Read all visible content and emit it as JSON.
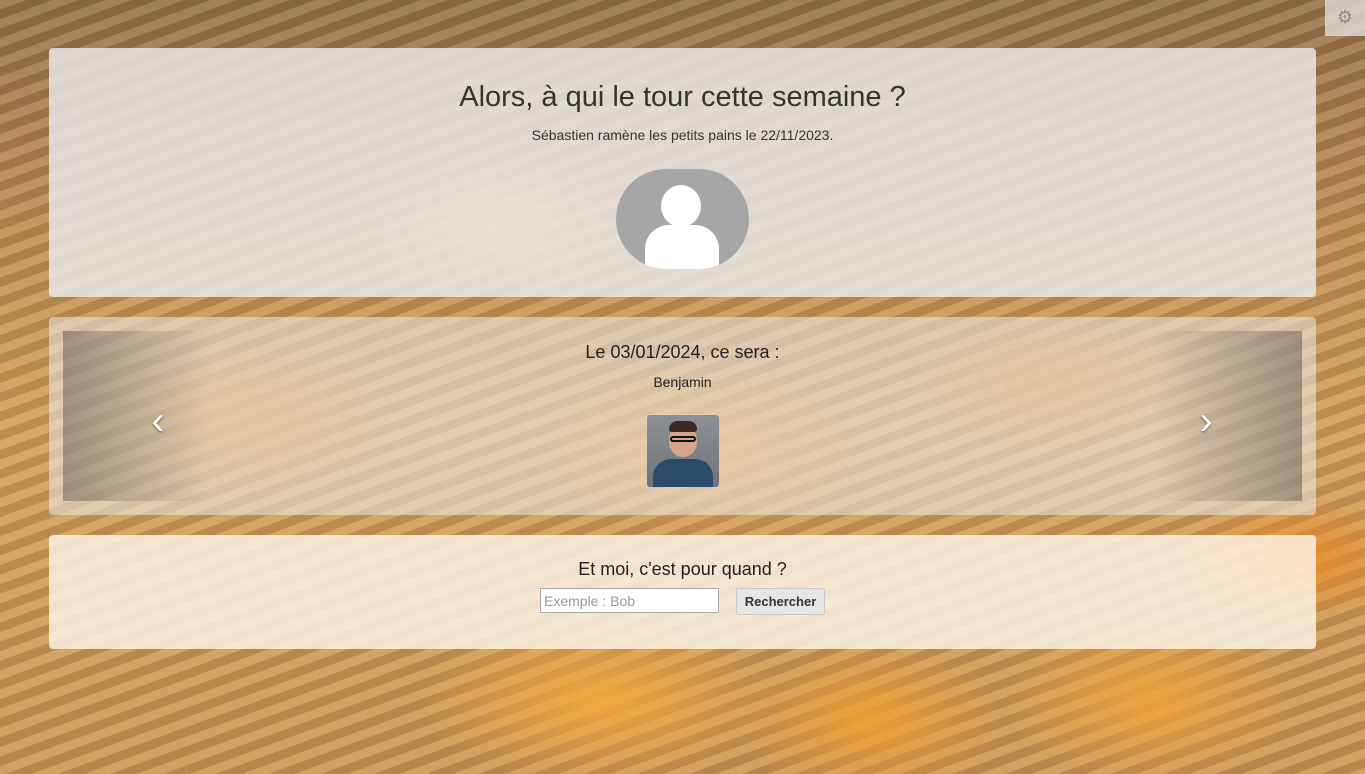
{
  "settings": {
    "icon": "gear-icon"
  },
  "current": {
    "title": "Alors, à qui le tour cette semaine ?",
    "subtitle": "Sébastien ramène les petits pains le 22/11/2023.",
    "avatar": "user-placeholder-icon"
  },
  "carousel": {
    "slide_title": "Le 03/01/2024, ce sera :",
    "slide_name": "Benjamin",
    "prev_icon": "chevron-left-icon",
    "next_icon": "chevron-right-icon"
  },
  "search": {
    "title": "Et moi, c'est pour quand ?",
    "placeholder": "Exemple : Bob",
    "value": "",
    "button_label": "Rechercher"
  }
}
